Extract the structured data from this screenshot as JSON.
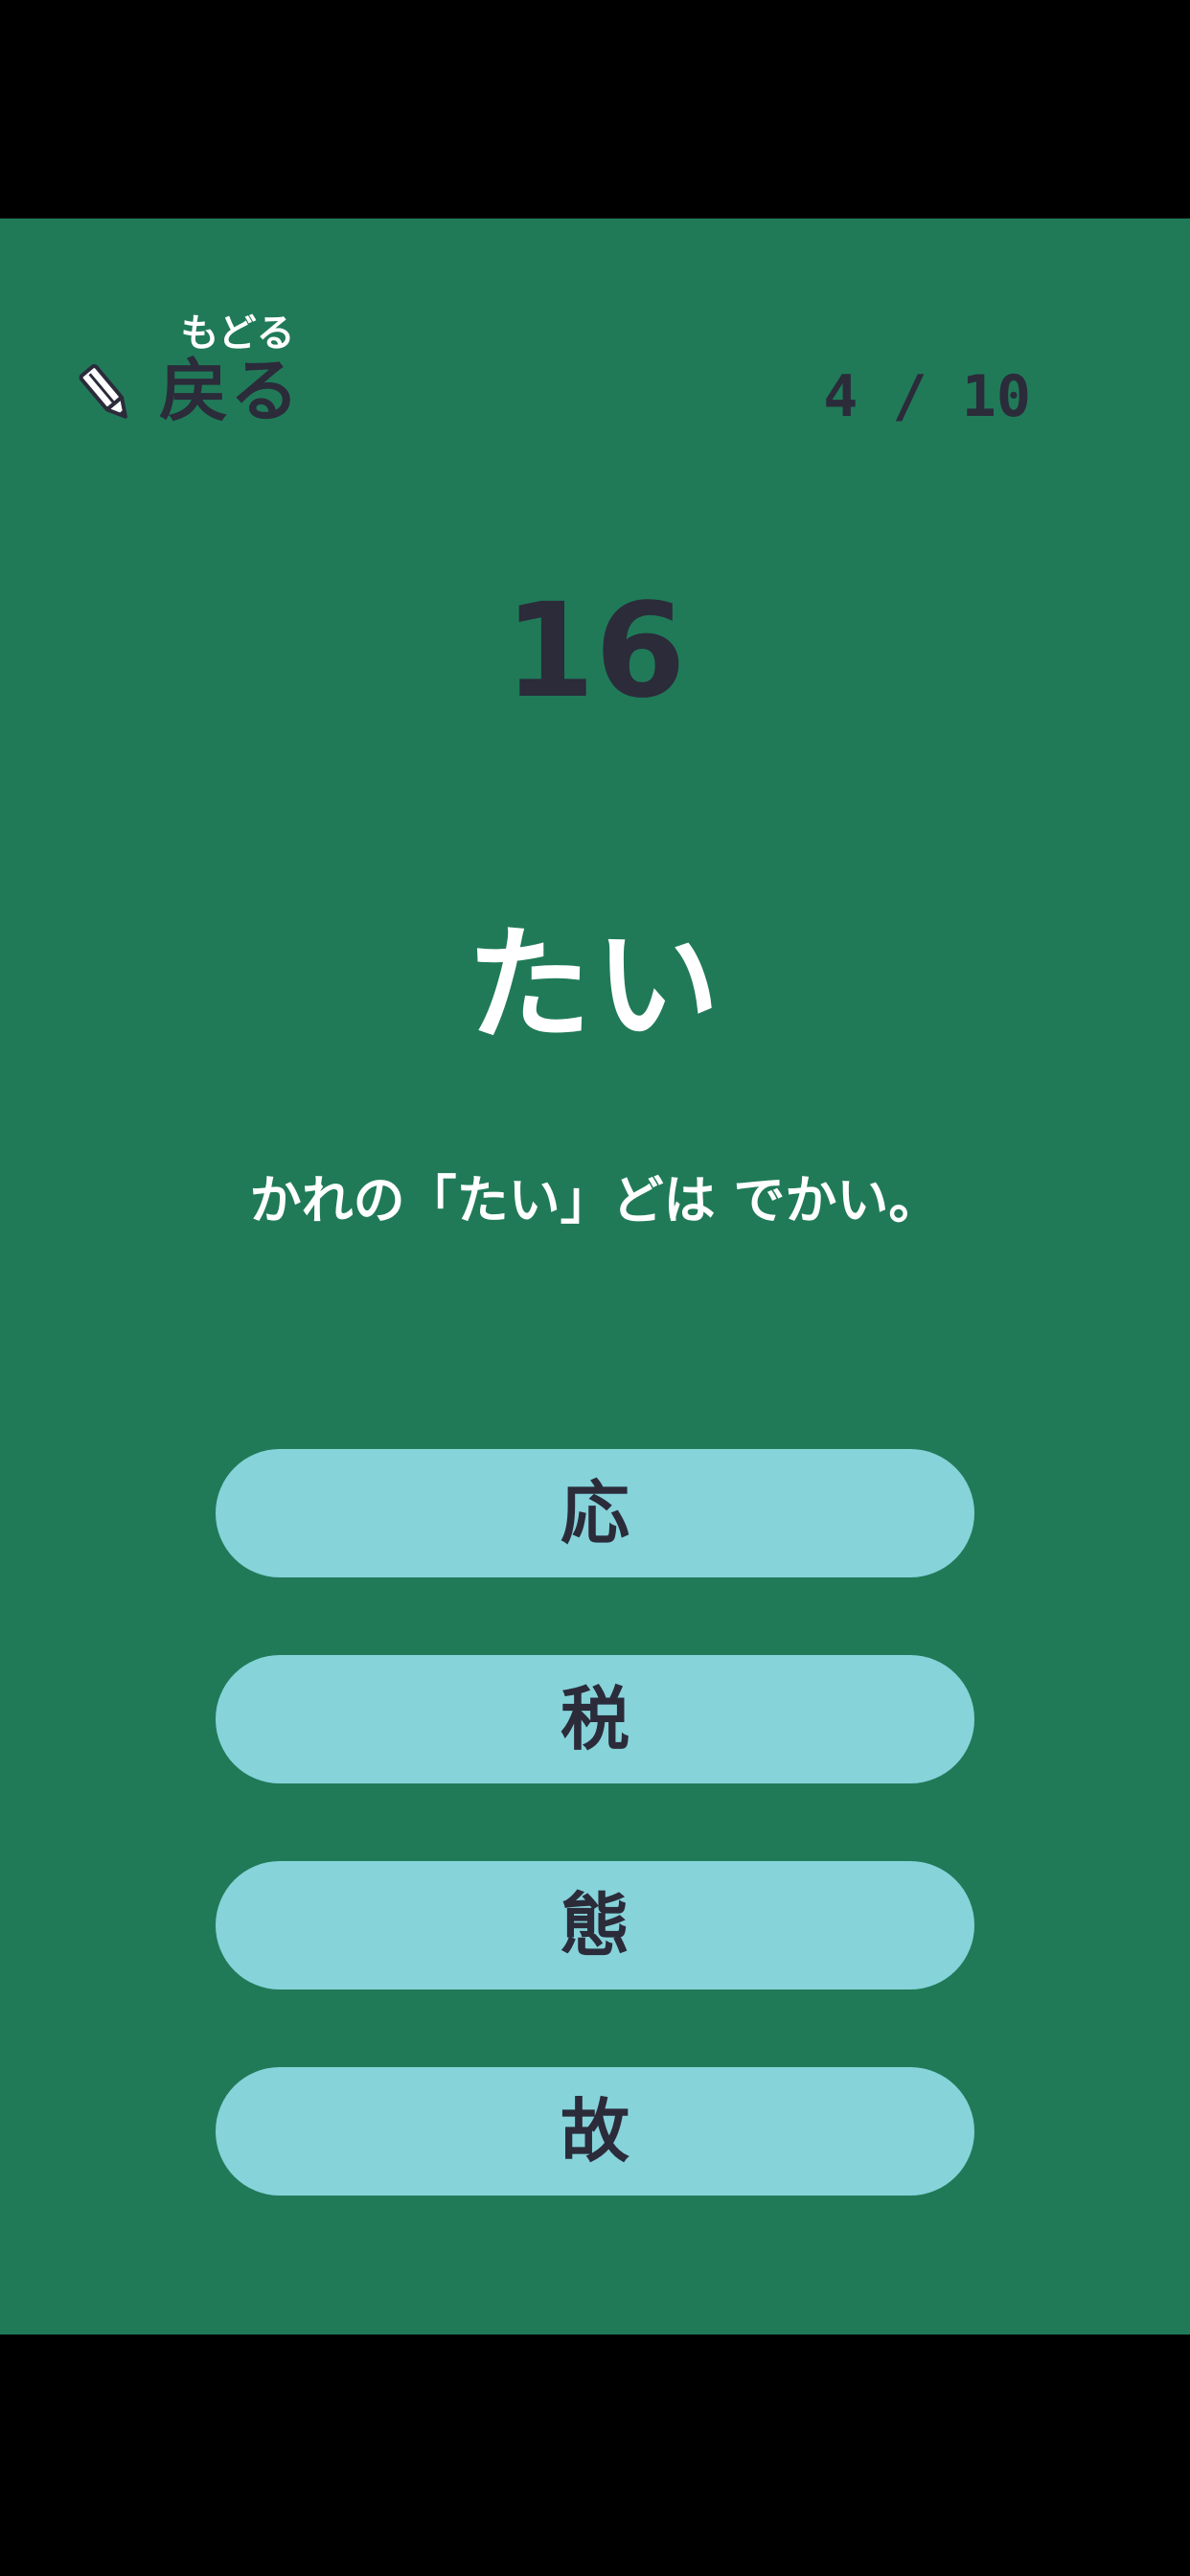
{
  "header": {
    "back_ruby": "もどる",
    "back_label": "戻る",
    "progress": "4 / 10"
  },
  "question": {
    "timer": "16",
    "reading": "たい",
    "sentence": "かれの「たい」どは でかい。"
  },
  "choices": [
    {
      "label": "応"
    },
    {
      "label": "税"
    },
    {
      "label": "態"
    },
    {
      "label": "故"
    }
  ],
  "colors": {
    "background": "#207a58",
    "choice_fill": "#86d3da",
    "dark_text": "#2b2b3a",
    "light_text": "#ffffff"
  }
}
